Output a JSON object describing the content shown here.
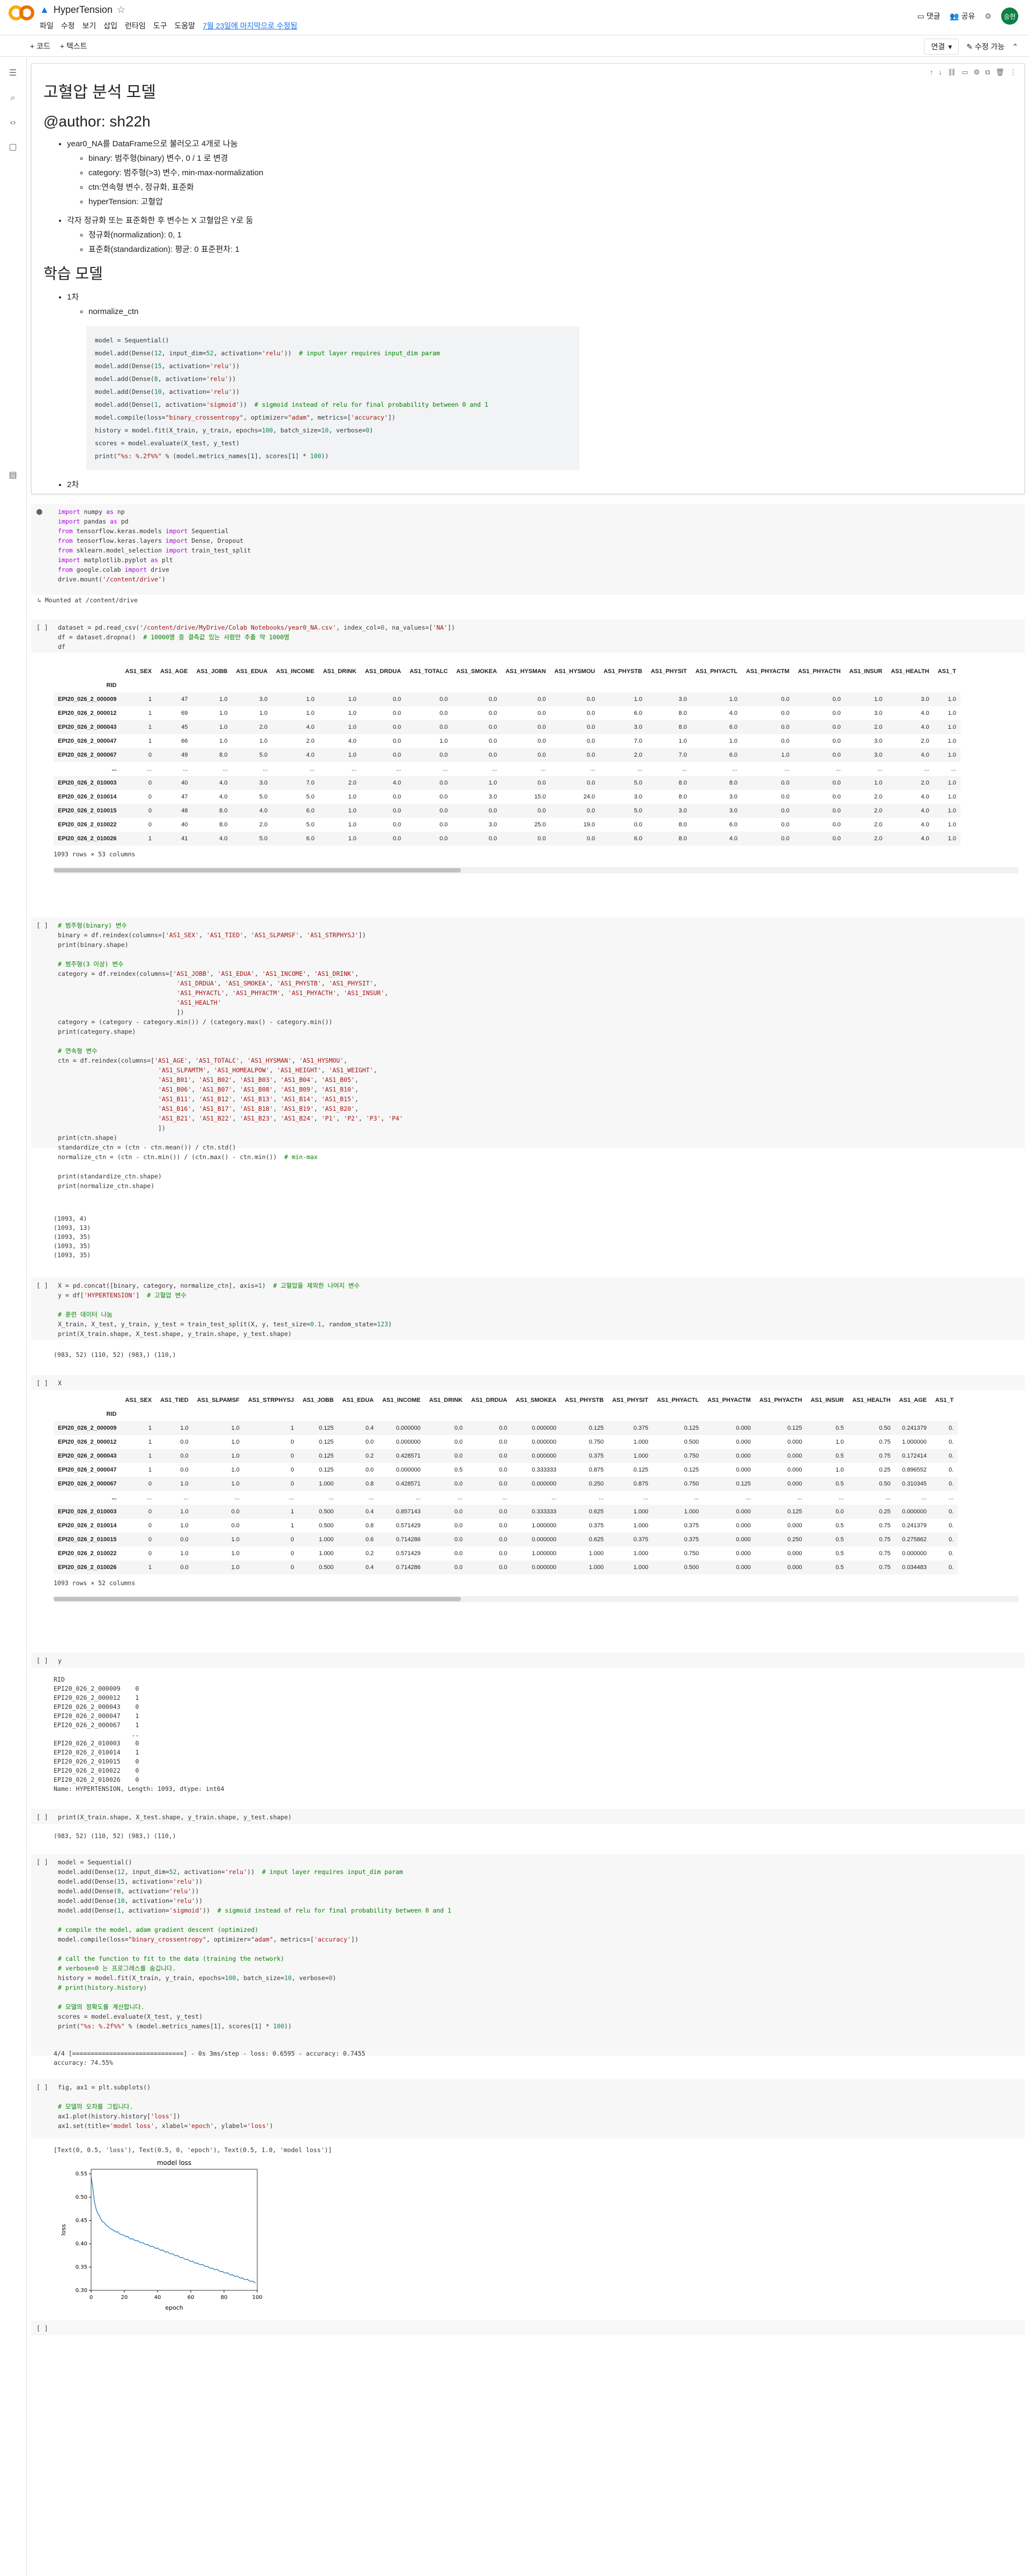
{
  "app": {
    "title": "HyperTension",
    "menus": [
      "파일",
      "수정",
      "보기",
      "삽입",
      "런타임",
      "도구",
      "도움말"
    ],
    "last_edit": "7월 23일에 마지막으로 수정됨"
  },
  "top_actions": {
    "comment": "댓글",
    "share": "공유",
    "user": "승현"
  },
  "toolbar": {
    "code": "+ 코드",
    "text": "+ 텍스트",
    "connect": "연결",
    "edit": "수정 가능"
  },
  "text_cell": {
    "title": "고혈압 분석 모델",
    "author": "@author: sh22h",
    "bullets": [
      {
        "text": "year0_NA를 DataFrame으로 불러오고 4개로 나눔",
        "sub": [
          "binary: 범주형(binary) 변수, 0 / 1 로 변경",
          "category: 범주형(>3) 변수, min-max-normalization",
          "ctn:연속형 변수, 정규화, 표준화",
          "hyperTension: 고혈압"
        ]
      },
      {
        "text": "각자 정규화 또는 표준화한 후 변수는 X 고혈압은 Y로 둠",
        "sub": [
          "정규화(normalization): 0, 1",
          "표준화(standardization): 평균: 0 표준편차: 1"
        ]
      }
    ],
    "h2": "학습 모델",
    "first": "1차",
    "first_sub": "normalize_ctn",
    "code": [
      "model = Sequential()",
      "model.add(Dense(12, input_dim=52, activation='relu'))  # input layer requires input_dim param",
      "model.add(Dense(15, activation='relu'))",
      "model.add(Dense(8, activation='relu'))",
      "model.add(Dense(10, activation='relu'))",
      "model.add(Dense(1, activation='sigmoid'))  # sigmoid instead of relu for final probability between 0 and 1",
      "model.compile(loss=\"binary_crossentropy\", optimizer=\"adam\", metrics=['accuracy'])",
      "history = model.fit(X_train, y_train, epochs=100, batch_size=10, verbose=0)",
      "scores = model.evaluate(X_test, y_test)",
      "print(\"%s: %.2f%%\" % (model.metrics_names[1], scores[1] * 100))"
    ],
    "second": "2차"
  },
  "cell1": {
    "lines": [
      "import numpy as np",
      "import pandas as pd",
      "from tensorflow.keras.models import Sequential",
      "from tensorflow.keras.layers import Dense, Dropout",
      "from sklearn.model_selection import train_test_split",
      "import matplotlib.pyplot as plt",
      "from google.colab import drive",
      "drive.mount('/content/drive')"
    ],
    "output": "Mounted at /content/drive"
  },
  "cell2": {
    "lines": [
      "dataset = pd.read_csv('/content/drive/MyDrive/Colab Notebooks/year0_NA.csv', index_col=0, na_values=['NA'])",
      "df = dataset.dropna()  # 10000명 중 결측값 있는 사람만 추출 약 1000명",
      "df"
    ]
  },
  "table1": {
    "columns": [
      "AS1_SEX",
      "AS1_AGE",
      "AS1_JOBB",
      "AS1_EDUA",
      "AS1_INCOME",
      "AS1_DRINK",
      "AS1_DRDUA",
      "AS1_TOTALC",
      "AS1_SMOKEA",
      "AS1_HYSMAN",
      "AS1_HYSMOU",
      "AS1_PHYSTB",
      "AS1_PHYSIT",
      "AS1_PHYACTL",
      "AS1_PHYACTM",
      "AS1_PHYACTH",
      "AS1_INSUR",
      "AS1_HEALTH",
      "AS1_T"
    ],
    "index_name": "RID",
    "rows": [
      [
        "EPI20_026_2_000009",
        "1",
        "47",
        "1.0",
        "3.0",
        "1.0",
        "1.0",
        "0.0",
        "0.0",
        "0.0",
        "0.0",
        "0.0",
        "1.0",
        "3.0",
        "1.0",
        "0.0",
        "0.0",
        "1.0",
        "3.0",
        "1.0"
      ],
      [
        "EPI20_026_2_000012",
        "1",
        "69",
        "1.0",
        "1.0",
        "1.0",
        "1.0",
        "0.0",
        "0.0",
        "0.0",
        "0.0",
        "0.0",
        "6.0",
        "8.0",
        "4.0",
        "0.0",
        "0.0",
        "3.0",
        "4.0",
        "1.0"
      ],
      [
        "EPI20_026_2_000043",
        "1",
        "45",
        "1.0",
        "2.0",
        "4.0",
        "1.0",
        "0.0",
        "0.0",
        "0.0",
        "0.0",
        "0.0",
        "3.0",
        "8.0",
        "6.0",
        "0.0",
        "0.0",
        "2.0",
        "4.0",
        "1.0"
      ],
      [
        "EPI20_026_2_000047",
        "1",
        "66",
        "1.0",
        "1.0",
        "2.0",
        "4.0",
        "0.0",
        "1.0",
        "0.0",
        "0.0",
        "0.0",
        "7.0",
        "1.0",
        "1.0",
        "0.0",
        "0.0",
        "3.0",
        "2.0",
        "1.0"
      ],
      [
        "EPI20_026_2_000067",
        "0",
        "49",
        "8.0",
        "5.0",
        "4.0",
        "1.0",
        "0.0",
        "0.0",
        "0.0",
        "0.0",
        "0.0",
        "2.0",
        "7.0",
        "6.0",
        "1.0",
        "0.0",
        "3.0",
        "4.0",
        "1.0"
      ],
      [
        "...",
        "...",
        "...",
        "...",
        "...",
        "...",
        "...",
        "...",
        "...",
        "...",
        "...",
        "...",
        "...",
        "...",
        "...",
        "...",
        "...",
        "...",
        "...",
        "..."
      ],
      [
        "EPI20_026_2_010003",
        "0",
        "40",
        "4.0",
        "3.0",
        "7.0",
        "2.0",
        "4.0",
        "0.0",
        "1.0",
        "0.0",
        "0.0",
        "5.0",
        "8.0",
        "8.0",
        "0.0",
        "0.0",
        "1.0",
        "2.0",
        "1.0"
      ],
      [
        "EPI20_026_2_010014",
        "0",
        "47",
        "4.0",
        "5.0",
        "5.0",
        "1.0",
        "0.0",
        "0.0",
        "3.0",
        "15.0",
        "24.0",
        "3.0",
        "8.0",
        "3.0",
        "0.0",
        "0.0",
        "2.0",
        "4.0",
        "1.0"
      ],
      [
        "EPI20_026_2_010015",
        "0",
        "48",
        "8.0",
        "4.0",
        "6.0",
        "1.0",
        "0.0",
        "0.0",
        "0.0",
        "0.0",
        "0.0",
        "5.0",
        "3.0",
        "3.0",
        "0.0",
        "0.0",
        "2.0",
        "4.0",
        "1.0"
      ],
      [
        "EPI20_026_2_010022",
        "0",
        "40",
        "8.0",
        "2.0",
        "5.0",
        "1.0",
        "0.0",
        "0.0",
        "3.0",
        "25.0",
        "19.0",
        "0.0",
        "8.0",
        "6.0",
        "0.0",
        "0.0",
        "2.0",
        "4.0",
        "1.0"
      ],
      [
        "EPI20_026_2_010026",
        "1",
        "41",
        "4.0",
        "5.0",
        "6.0",
        "1.0",
        "0.0",
        "0.0",
        "0.0",
        "0.0",
        "0.0",
        "6.0",
        "8.0",
        "4.0",
        "0.0",
        "0.0",
        "2.0",
        "4.0",
        "1.0"
      ]
    ],
    "footer": "1093 rows × 53 columns"
  },
  "cell3": {
    "lines": [
      "# 범주형(binary) 변수",
      "binary = df.reindex(columns=['AS1_SEX', 'AS1_TIED', 'AS1_SLPAMSF', 'AS1_STRPHYSJ'])",
      "print(binary.shape)",
      "",
      "# 범주형(3 이상) 변수",
      "category = df.reindex(columns=['AS1_JOBB', 'AS1_EDUA', 'AS1_INCOME', 'AS1_DRINK',",
      "                                'AS1_DRDUA', 'AS1_SMOKEA', 'AS1_PHYSTB', 'AS1_PHYSIT',",
      "                                'AS1_PHYACTL', 'AS1_PHYACTM', 'AS1_PHYACTH', 'AS1_INSUR',",
      "                                'AS1_HEALTH'",
      "                                ])",
      "category = (category - category.min()) / (category.max() - category.min())",
      "print(category.shape)",
      "",
      "# 연속형 변수",
      "ctn = df.reindex(columns=['AS1_AGE', 'AS1_TOTALC', 'AS1_HYSMAN', 'AS1_HYSMOU',",
      "                           'AS1_SLPAMTM', 'AS1_HOMEALPOW', 'AS1_HEIGHT', 'AS1_WEIGHT',",
      "                           'AS1_B01', 'AS1_B02', 'AS1_B03', 'AS1_B04', 'AS1_B05',",
      "                           'AS1_B06', 'AS1_B07', 'AS1_B08', 'AS1_B09', 'AS1_B10',",
      "                           'AS1_B11', 'AS1_B12', 'AS1_B13', 'AS1_B14', 'AS1_B15',",
      "                           'AS1_B16', 'AS1_B17', 'AS1_B18', 'AS1_B19', 'AS1_B20',",
      "                           'AS1_B21', 'AS1_B22', 'AS1_B23', 'AS1_B24', 'P1', 'P2', 'P3', 'P4'",
      "                           ])",
      "print(ctn.shape)",
      "standardize_ctn = (ctn - ctn.mean()) / ctn.std()",
      "normalize_ctn = (ctn - ctn.min()) / (ctn.max() - ctn.min())  # min-max",
      "",
      "print(standardize_ctn.shape)",
      "print(normalize_ctn.shape)"
    ],
    "output": [
      "(1093, 4)",
      "(1093, 13)",
      "(1093, 35)",
      "(1093, 35)",
      "(1093, 35)"
    ]
  },
  "cell4": {
    "lines": [
      "X = pd.concat([binary, category, normalize_ctn], axis=1)  # 고혈압을 제외한 나머지 변수",
      "y = df['HYPERTENSION']  # 고혈압 변수",
      "",
      "# 훈련 데이터 나눔",
      "X_train, X_test, y_train, y_test = train_test_split(X, y, test_size=0.1, random_state=123)",
      "print(X_train.shape, X_test.shape, y_train.shape, y_test.shape)"
    ],
    "output": "(983, 52) (110, 52) (983,) (110,)"
  },
  "cell5": {
    "lines": [
      "X"
    ]
  },
  "table2": {
    "columns": [
      "AS1_SEX",
      "AS1_TIED",
      "AS1_SLPAMSF",
      "AS1_STRPHYSJ",
      "AS1_JOBB",
      "AS1_EDUA",
      "AS1_INCOME",
      "AS1_DRINK",
      "AS1_DRDUA",
      "AS1_SMOKEA",
      "AS1_PHYSTB",
      "AS1_PHYSIT",
      "AS1_PHYACTL",
      "AS1_PHYACTM",
      "AS1_PHYACTH",
      "AS1_INSUR",
      "AS1_HEALTH",
      "AS1_AGE",
      "AS1_T"
    ],
    "index_name": "RID",
    "rows": [
      [
        "EPI20_026_2_000009",
        "1",
        "1.0",
        "1.0",
        "1",
        "0.125",
        "0.4",
        "0.000000",
        "0.0",
        "0.0",
        "0.000000",
        "0.125",
        "0.375",
        "0.125",
        "0.000",
        "0.125",
        "0.5",
        "0.50",
        "0.241379",
        "0."
      ],
      [
        "EPI20_026_2_000012",
        "1",
        "0.0",
        "1.0",
        "0",
        "0.125",
        "0.0",
        "0.000000",
        "0.0",
        "0.0",
        "0.000000",
        "0.750",
        "1.000",
        "0.500",
        "0.000",
        "0.000",
        "1.0",
        "0.75",
        "1.000000",
        "0."
      ],
      [
        "EPI20_026_2_000043",
        "1",
        "0.0",
        "1.0",
        "0",
        "0.125",
        "0.2",
        "0.428571",
        "0.0",
        "0.0",
        "0.000000",
        "0.375",
        "1.000",
        "0.750",
        "0.000",
        "0.000",
        "0.5",
        "0.75",
        "0.172414",
        "0."
      ],
      [
        "EPI20_026_2_000047",
        "1",
        "0.0",
        "1.0",
        "0",
        "0.125",
        "0.0",
        "0.000000",
        "0.5",
        "0.0",
        "0.333333",
        "0.875",
        "0.125",
        "0.125",
        "0.000",
        "0.000",
        "1.0",
        "0.25",
        "0.896552",
        "0."
      ],
      [
        "EPI20_026_2_000067",
        "0",
        "1.0",
        "1.0",
        "0",
        "1.000",
        "0.8",
        "0.428571",
        "0.0",
        "0.0",
        "0.000000",
        "0.250",
        "0.875",
        "0.750",
        "0.125",
        "0.000",
        "0.5",
        "0.50",
        "0.310345",
        "0."
      ],
      [
        "...",
        "...",
        "...",
        "...",
        "...",
        "...",
        "...",
        "...",
        "...",
        "...",
        "...",
        "...",
        "...",
        "...",
        "...",
        "...",
        "...",
        "...",
        "...",
        "..."
      ],
      [
        "EPI20_026_2_010003",
        "0",
        "1.0",
        "0.0",
        "1",
        "0.500",
        "0.4",
        "0.857143",
        "0.0",
        "0.0",
        "0.333333",
        "0.625",
        "1.000",
        "1.000",
        "0.000",
        "0.125",
        "0.0",
        "0.25",
        "0.000000",
        "0."
      ],
      [
        "EPI20_026_2_010014",
        "0",
        "1.0",
        "0.0",
        "1",
        "0.500",
        "0.8",
        "0.571429",
        "0.0",
        "0.0",
        "1.000000",
        "0.375",
        "1.000",
        "0.375",
        "0.000",
        "0.000",
        "0.5",
        "0.75",
        "0.241379",
        "0."
      ],
      [
        "EPI20_026_2_010015",
        "0",
        "0.0",
        "1.0",
        "0",
        "1.000",
        "0.6",
        "0.714286",
        "0.0",
        "0.0",
        "0.000000",
        "0.625",
        "0.375",
        "0.375",
        "0.000",
        "0.250",
        "0.5",
        "0.75",
        "0.275862",
        "0."
      ],
      [
        "EPI20_026_2_010022",
        "0",
        "1.0",
        "1.0",
        "0",
        "1.000",
        "0.2",
        "0.571429",
        "0.0",
        "0.0",
        "1.000000",
        "1.000",
        "1.000",
        "0.750",
        "0.000",
        "0.000",
        "0.5",
        "0.75",
        "0.000000",
        "0."
      ],
      [
        "EPI20_026_2_010026",
        "1",
        "0.0",
        "1.0",
        "0",
        "0.500",
        "0.4",
        "0.714286",
        "0.0",
        "0.0",
        "0.000000",
        "1.000",
        "1.000",
        "0.500",
        "0.000",
        "0.000",
        "0.5",
        "0.75",
        "0.034483",
        "0."
      ]
    ],
    "footer": "1093 rows × 52 columns"
  },
  "cell6": {
    "lines": [
      "y"
    ],
    "output": [
      "RID",
      "EPI20_026_2_000009    0",
      "EPI20_026_2_000012    1",
      "EPI20_026_2_000043    0",
      "EPI20_026_2_000047    1",
      "EPI20_026_2_000067    1",
      "                     ..",
      "EPI20_026_2_010003    0",
      "EPI20_026_2_010014    1",
      "EPI20_026_2_010015    0",
      "EPI20_026_2_010022    0",
      "EPI20_026_2_010026    0",
      "Name: HYPERTENSION, Length: 1093, dtype: int64"
    ]
  },
  "cell7": {
    "lines": [
      "print(X_train.shape, X_test.shape, y_train.shape, y_test.shape)"
    ],
    "output": "(983, 52) (110, 52) (983,) (110,)"
  },
  "cell8": {
    "lines": [
      "model = Sequential()",
      "model.add(Dense(12, input_dim=52, activation='relu'))  # input layer requires input_dim param",
      "model.add(Dense(15, activation='relu'))",
      "model.add(Dense(8, activation='relu'))",
      "model.add(Dense(10, activation='relu'))",
      "model.add(Dense(1, activation='sigmoid'))  # sigmoid instead of relu for final probability between 0 and 1",
      "",
      "# compile the model, adam gradient descent (optimized)",
      "model.compile(loss=\"binary_crossentropy\", optimizer=\"adam\", metrics=['accuracy'])",
      "",
      "# call the function to fit to the data (training the network)",
      "# verbose=0 는 프로그래스를 숨깁니다.",
      "history = model.fit(X_train, y_train, epochs=100, batch_size=10, verbose=0)",
      "# print(history.history)",
      "",
      "# 모델의 정확도를 계산합니다.",
      "scores = model.evaluate(X_test, y_test)",
      "print(\"%s: %.2f%%\" % (model.metrics_names[1], scores[1] * 100))"
    ],
    "output": [
      "4/4 [==============================] - 0s 3ms/step - loss: 0.6595 - accuracy: 0.7455",
      "accuracy: 74.55%"
    ]
  },
  "cell9": {
    "lines": [
      "fig, ax1 = plt.subplots()",
      "",
      "# 모델의 오차를 그립니다.",
      "ax1.plot(history.history['loss'])",
      "ax1.set(title='model loss', xlabel='epoch', ylabel='loss')"
    ],
    "output": "[Text(0, 0.5, 'loss'), Text(0.5, 0, 'epoch'), Text(0.5, 1.0, 'model loss')]"
  },
  "cell10": {
    "lines": [
      ""
    ]
  },
  "run_empty": "[ ]",
  "chart_data": {
    "type": "line",
    "title": "model loss",
    "xlabel": "epoch",
    "ylabel": "loss",
    "xlim": [
      0,
      100
    ],
    "ylim": [
      0.3,
      0.56
    ],
    "xticks": [
      0,
      20,
      40,
      60,
      80,
      100
    ],
    "yticks": [
      0.3,
      0.35,
      0.4,
      0.45,
      0.5,
      0.55
    ],
    "series": [
      {
        "color": "#1f77b4",
        "values": [
          0.545,
          0.52,
          0.49,
          0.475,
          0.465,
          0.46,
          0.452,
          0.447,
          0.445,
          0.44,
          0.438,
          0.434,
          0.432,
          0.43,
          0.428,
          0.425,
          0.426,
          0.422,
          0.42,
          0.419,
          0.418,
          0.415,
          0.416,
          0.412,
          0.41,
          0.411,
          0.408,
          0.406,
          0.407,
          0.404,
          0.402,
          0.403,
          0.4,
          0.398,
          0.399,
          0.396,
          0.394,
          0.395,
          0.392,
          0.39,
          0.391,
          0.388,
          0.386,
          0.387,
          0.384,
          0.382,
          0.383,
          0.38,
          0.378,
          0.379,
          0.376,
          0.374,
          0.375,
          0.372,
          0.37,
          0.371,
          0.368,
          0.366,
          0.367,
          0.364,
          0.362,
          0.363,
          0.36,
          0.358,
          0.359,
          0.356,
          0.355,
          0.356,
          0.353,
          0.351,
          0.352,
          0.349,
          0.347,
          0.348,
          0.345,
          0.344,
          0.345,
          0.342,
          0.34,
          0.341,
          0.338,
          0.337,
          0.338,
          0.335,
          0.333,
          0.334,
          0.331,
          0.33,
          0.331,
          0.328,
          0.326,
          0.327,
          0.324,
          0.323,
          0.324,
          0.321,
          0.319,
          0.32,
          0.318,
          0.316
        ]
      }
    ]
  }
}
